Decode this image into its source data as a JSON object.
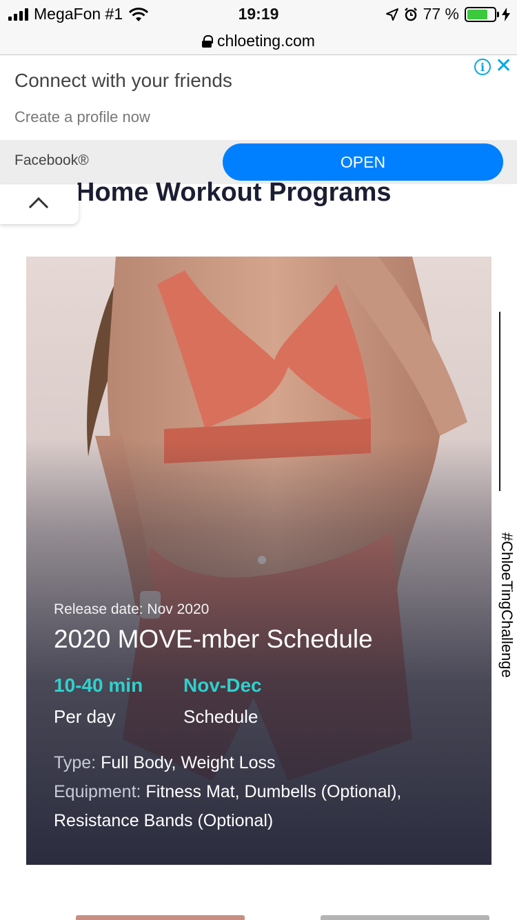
{
  "status_bar": {
    "carrier": "MegaFon #1",
    "time": "19:19",
    "battery_percent": "77 %",
    "battery_level": 0.77,
    "battery_color": "#3cc93c"
  },
  "browser": {
    "url": "chloeting.com"
  },
  "ad": {
    "title": "Connect with your friends",
    "subtitle": "Create a profile now",
    "source": "Facebook®",
    "button": "OPEN",
    "button_color": "#0080ff",
    "icons": [
      "info-icon",
      "close-icon"
    ]
  },
  "page": {
    "section_title": "Home Workout Programs",
    "hashtag": "#ChloeTingChallenge"
  },
  "program": {
    "release": "Release date: Nov 2020",
    "title": "2020 MOVE-mber Schedule",
    "stats": [
      {
        "value": "10-40 min",
        "label": "Per day"
      },
      {
        "value": "Nov-Dec",
        "label": "Schedule"
      }
    ],
    "type_label": "Type:",
    "type_value": "Full Body, Weight Loss",
    "equipment_label": "Equipment:",
    "equipment_value": "Fitness Mat, Dumbells (Optional), Resistance Bands (Optional)",
    "accent_color": "#2fd1cd"
  }
}
